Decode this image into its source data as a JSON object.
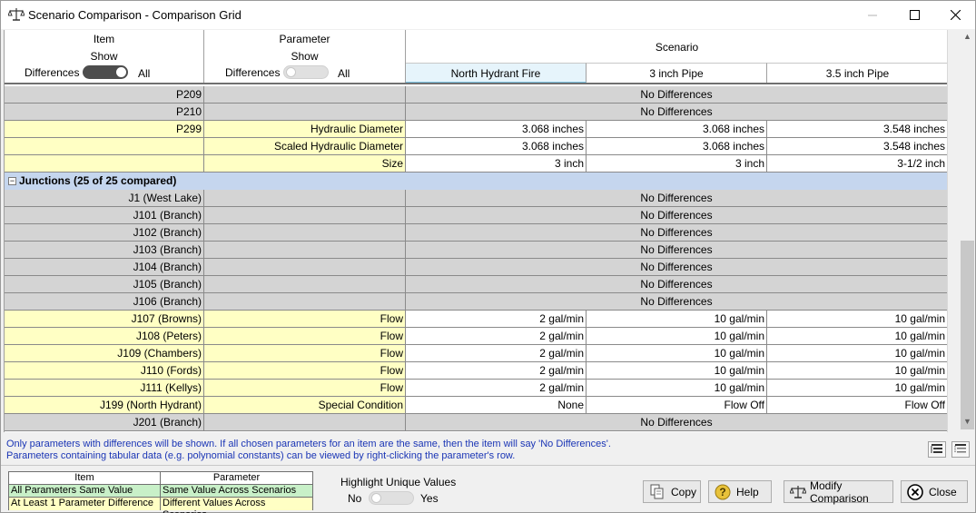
{
  "window": {
    "title": "Scenario Comparison - Comparison Grid",
    "icons": {
      "app": "scales-icon",
      "minimize": "minimize-icon",
      "maximize": "maximize-icon",
      "close": "close-icon"
    }
  },
  "header": {
    "item": {
      "label": "Item",
      "show_label": "Show",
      "left_label": "Differences",
      "right_label": "All",
      "toggle_state": "on"
    },
    "parameter": {
      "label": "Parameter",
      "show_label": "Show",
      "left_label": "Differences",
      "right_label": "All",
      "toggle_state": "off"
    },
    "scenario": {
      "label": "Scenario",
      "columns": [
        "North Hydrant Fire",
        "3 inch Pipe",
        "3.5 inch Pipe"
      ],
      "selected_column": 0
    }
  },
  "rows": [
    {
      "type": "nodiff",
      "item": "P209",
      "text": "No Differences"
    },
    {
      "type": "nodiff",
      "item": "P210",
      "text": "No Differences"
    },
    {
      "type": "diff",
      "item": "P299",
      "param": "Hydraulic Diameter",
      "values": [
        "3.068 inches",
        "3.068 inches",
        "3.548 inches"
      ]
    },
    {
      "type": "diff",
      "item": "",
      "param": "Scaled Hydraulic Diameter",
      "values": [
        "3.068 inches",
        "3.068 inches",
        "3.548 inches"
      ]
    },
    {
      "type": "diff",
      "item": "",
      "param": "Size",
      "values": [
        "3 inch",
        "3 inch",
        "3-1/2 inch"
      ]
    },
    {
      "type": "group",
      "label": "Junctions (25 of 25 compared)",
      "collapse_symbol": "−"
    },
    {
      "type": "nodiff",
      "item": "J1 (West Lake)",
      "text": "No Differences"
    },
    {
      "type": "nodiff",
      "item": "J101 (Branch)",
      "text": "No Differences"
    },
    {
      "type": "nodiff",
      "item": "J102 (Branch)",
      "text": "No Differences"
    },
    {
      "type": "nodiff",
      "item": "J103 (Branch)",
      "text": "No Differences"
    },
    {
      "type": "nodiff",
      "item": "J104 (Branch)",
      "text": "No Differences"
    },
    {
      "type": "nodiff",
      "item": "J105 (Branch)",
      "text": "No Differences"
    },
    {
      "type": "nodiff",
      "item": "J106 (Branch)",
      "text": "No Differences"
    },
    {
      "type": "diff",
      "item": "J107 (Browns)",
      "param": "Flow",
      "values": [
        "2 gal/min",
        "10 gal/min",
        "10 gal/min"
      ]
    },
    {
      "type": "diff",
      "item": "J108 (Peters)",
      "param": "Flow",
      "values": [
        "2 gal/min",
        "10 gal/min",
        "10 gal/min"
      ]
    },
    {
      "type": "diff",
      "item": "J109 (Chambers)",
      "param": "Flow",
      "values": [
        "2 gal/min",
        "10 gal/min",
        "10 gal/min"
      ]
    },
    {
      "type": "diff",
      "item": "J110 (Fords)",
      "param": "Flow",
      "values": [
        "2 gal/min",
        "10 gal/min",
        "10 gal/min"
      ]
    },
    {
      "type": "diff",
      "item": "J111 (Kellys)",
      "param": "Flow",
      "values": [
        "2 gal/min",
        "10 gal/min",
        "10 gal/min"
      ]
    },
    {
      "type": "diff",
      "item": "J199 (North Hydrant)",
      "param": "Special Condition",
      "values": [
        "None",
        "Flow Off",
        "Flow Off"
      ]
    },
    {
      "type": "nodiff",
      "item": "J201 (Branch)",
      "text": "No Differences"
    }
  ],
  "info": {
    "line1": "Only parameters with differences will be shown. If all chosen parameters for an item are the same, then the item will say 'No Differences'.",
    "line2": "Parameters containing tabular data (e.g. polynomial constants) can be viewed by right-clicking the parameter's row."
  },
  "legend": {
    "item_header": "Item",
    "parameter_header": "Parameter",
    "item_same": "All Parameters Same Value",
    "item_diff": "At Least 1 Parameter Difference",
    "param_same": "Same Value Across Scenarios",
    "param_diff": "Different Values Across Scenarios",
    "colors": {
      "same": "#c8f0c8",
      "diff": "#ffffc4"
    }
  },
  "highlight": {
    "label": "Highlight Unique Values",
    "no": "No",
    "yes": "Yes",
    "state": "off"
  },
  "buttons": {
    "copy": "Copy",
    "help": "Help",
    "modify": "Modify Comparison",
    "close": "Close"
  },
  "colors": {
    "nodiff_bg": "#d4d4d4",
    "diff_bg": "#ffffc4",
    "group_bg": "#c5d6ee",
    "selected_header": "#e6f4fb"
  }
}
